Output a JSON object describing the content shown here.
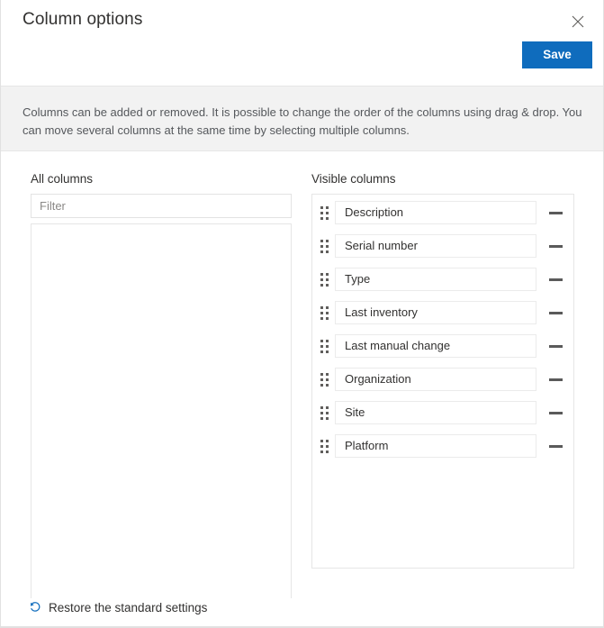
{
  "header": {
    "title": "Column options",
    "close_icon": "close-icon",
    "save_label": "Save",
    "accent_color": "#0f6cbd"
  },
  "banner": {
    "text": "Columns can be added or removed. It is possible to change the order of the columns using drag & drop. You can move several columns at the same time by selecting multiple columns.",
    "background_color": "#f2f2f2"
  },
  "all_columns": {
    "heading": "All columns",
    "filter_placeholder": "Filter",
    "filter_value": "",
    "items": []
  },
  "visible_columns": {
    "heading": "Visible columns",
    "drag_handle_icon": "drag-handle-icon",
    "remove_icon": "minus-icon",
    "items": [
      {
        "label": "Description"
      },
      {
        "label": "Serial number"
      },
      {
        "label": "Type"
      },
      {
        "label": "Last inventory"
      },
      {
        "label": "Last manual change"
      },
      {
        "label": "Organization"
      },
      {
        "label": "Site"
      },
      {
        "label": "Platform"
      }
    ]
  },
  "footer": {
    "restore_label": "Restore the standard settings",
    "restore_icon": "undo-arrow-icon",
    "restore_icon_color": "#0f6cbd"
  }
}
